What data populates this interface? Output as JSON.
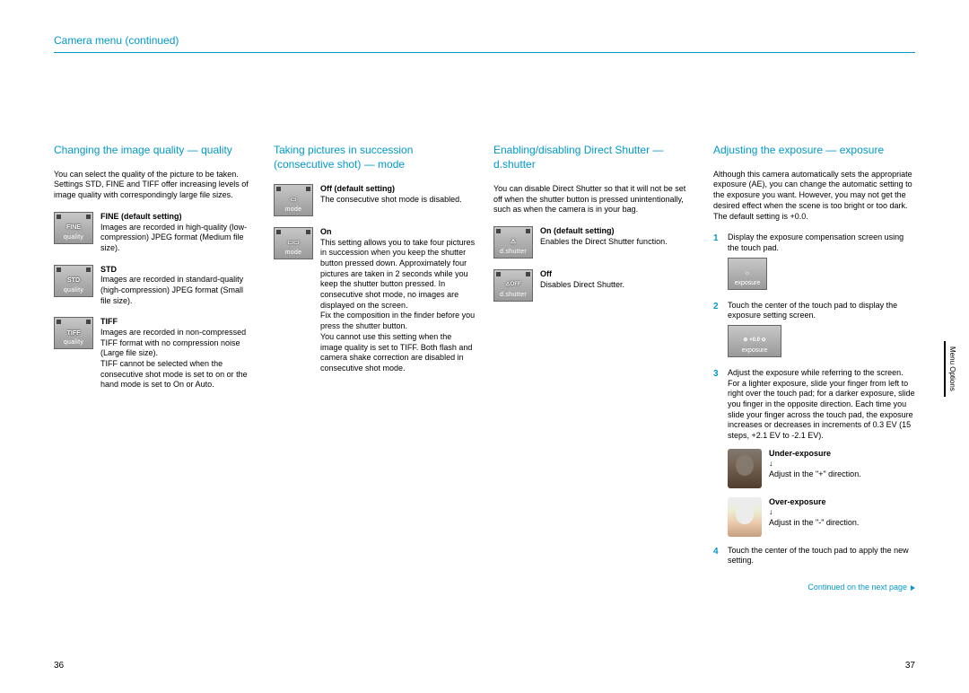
{
  "header": "Camera menu (continued)",
  "sideTab": "Menu Options",
  "pageLeft": "36",
  "pageRight": "37",
  "continuedText": "Continued on the next page",
  "col1": {
    "title": "Changing the image quality — quality",
    "intro": "You can select the quality of the picture to be taken. Settings STD, FINE and TIFF offer increasing levels of image quality with correspondingly large file sizes.",
    "items": [
      {
        "iconMid": "FINE",
        "iconLabel": "quality",
        "head": "FINE (default setting)",
        "body": "Images are recorded in high-quality (low-compression) JPEG format (Medium file size)."
      },
      {
        "iconMid": "STD",
        "iconLabel": "quality",
        "head": "STD",
        "body": "Images are recorded in standard-quality (high-compression) JPEG format (Small file size)."
      },
      {
        "iconMid": "TIFF",
        "iconLabel": "quality",
        "head": "TIFF",
        "body": "Images are recorded in non-compressed TIFF format with no compression noise (Large file size).\nTIFF cannot be selected when the consecutive shot mode is set to on or the hand mode is set to On or Auto."
      }
    ]
  },
  "col2": {
    "title": "Taking pictures in succession (consecutive shot) — mode",
    "items": [
      {
        "iconMid": "▭",
        "iconLabel": "mode",
        "head": "Off (default setting)",
        "body": "The consecutive shot mode is disabled."
      },
      {
        "iconMid": "▭▭",
        "iconLabel": "mode",
        "head": "On",
        "body": "This setting allows you to take four pictures in succession when you keep the shutter button pressed down. Approximately four pictures are taken in 2 seconds while you keep the shutter button pressed. In consecutive shot mode, no images are displayed on the screen.\nFix the composition in the finder before you press the shutter button.\nYou cannot use this setting when the image quality is set to TIFF. Both flash and camera shake correction are disabled in consecutive shot mode."
      }
    ]
  },
  "col3": {
    "title": "Enabling/disabling Direct Shutter — d.shutter",
    "intro": "You can disable Direct Shutter so that it will not be set off when the shutter button is pressed unintentionally, such as when the camera is in your bag.",
    "items": [
      {
        "iconMid": "⚠",
        "iconLabel": "d.shutter",
        "head": "On (default setting)",
        "body": "Enables the Direct Shutter function."
      },
      {
        "iconMid": "⚠OFF",
        "iconLabel": "d.shutter",
        "head": "Off",
        "body": "Disables Direct Shutter."
      }
    ]
  },
  "col4": {
    "title": "Adjusting the exposure — exposure",
    "intro": "Although this camera automatically sets the appropriate exposure (AE), you can change the automatic setting to the exposure you want. However, you may not get the desired effect when the scene is too bright or too dark.\nThe default setting is +0.0.",
    "steps": [
      {
        "n": "1",
        "body": "Display the exposure compensation screen using the touch pad.",
        "iconMid": "☼",
        "iconLabel": "exposure"
      },
      {
        "n": "2",
        "body": "Touch the center of the touch pad to display the exposure setting screen.",
        "iconMid": "⊕ +0.0 ⊖",
        "iconLabel": "exposure"
      },
      {
        "n": "3",
        "body": "Adjust the exposure while referring to the screen. For a lighter exposure, slide your finger from left to right over the touch pad; for a darker exposure, slide you finger in the opposite direction. Each time you slide your finger across the touch pad, the exposure increases or decreases in increments of 0.3 EV (15 steps, +2.1 EV to -2.1 EV)."
      },
      {
        "n": "4",
        "body": "Touch the center of the touch pad to apply the new setting."
      }
    ],
    "faces": [
      {
        "cls": "dark",
        "head": "Under-exposure",
        "arrow": "↓",
        "body": "Adjust in the \"+\" direction."
      },
      {
        "cls": "light",
        "head": "Over-exposure",
        "arrow": "↓",
        "body": "Adjust in the \"-\" direction."
      }
    ]
  }
}
